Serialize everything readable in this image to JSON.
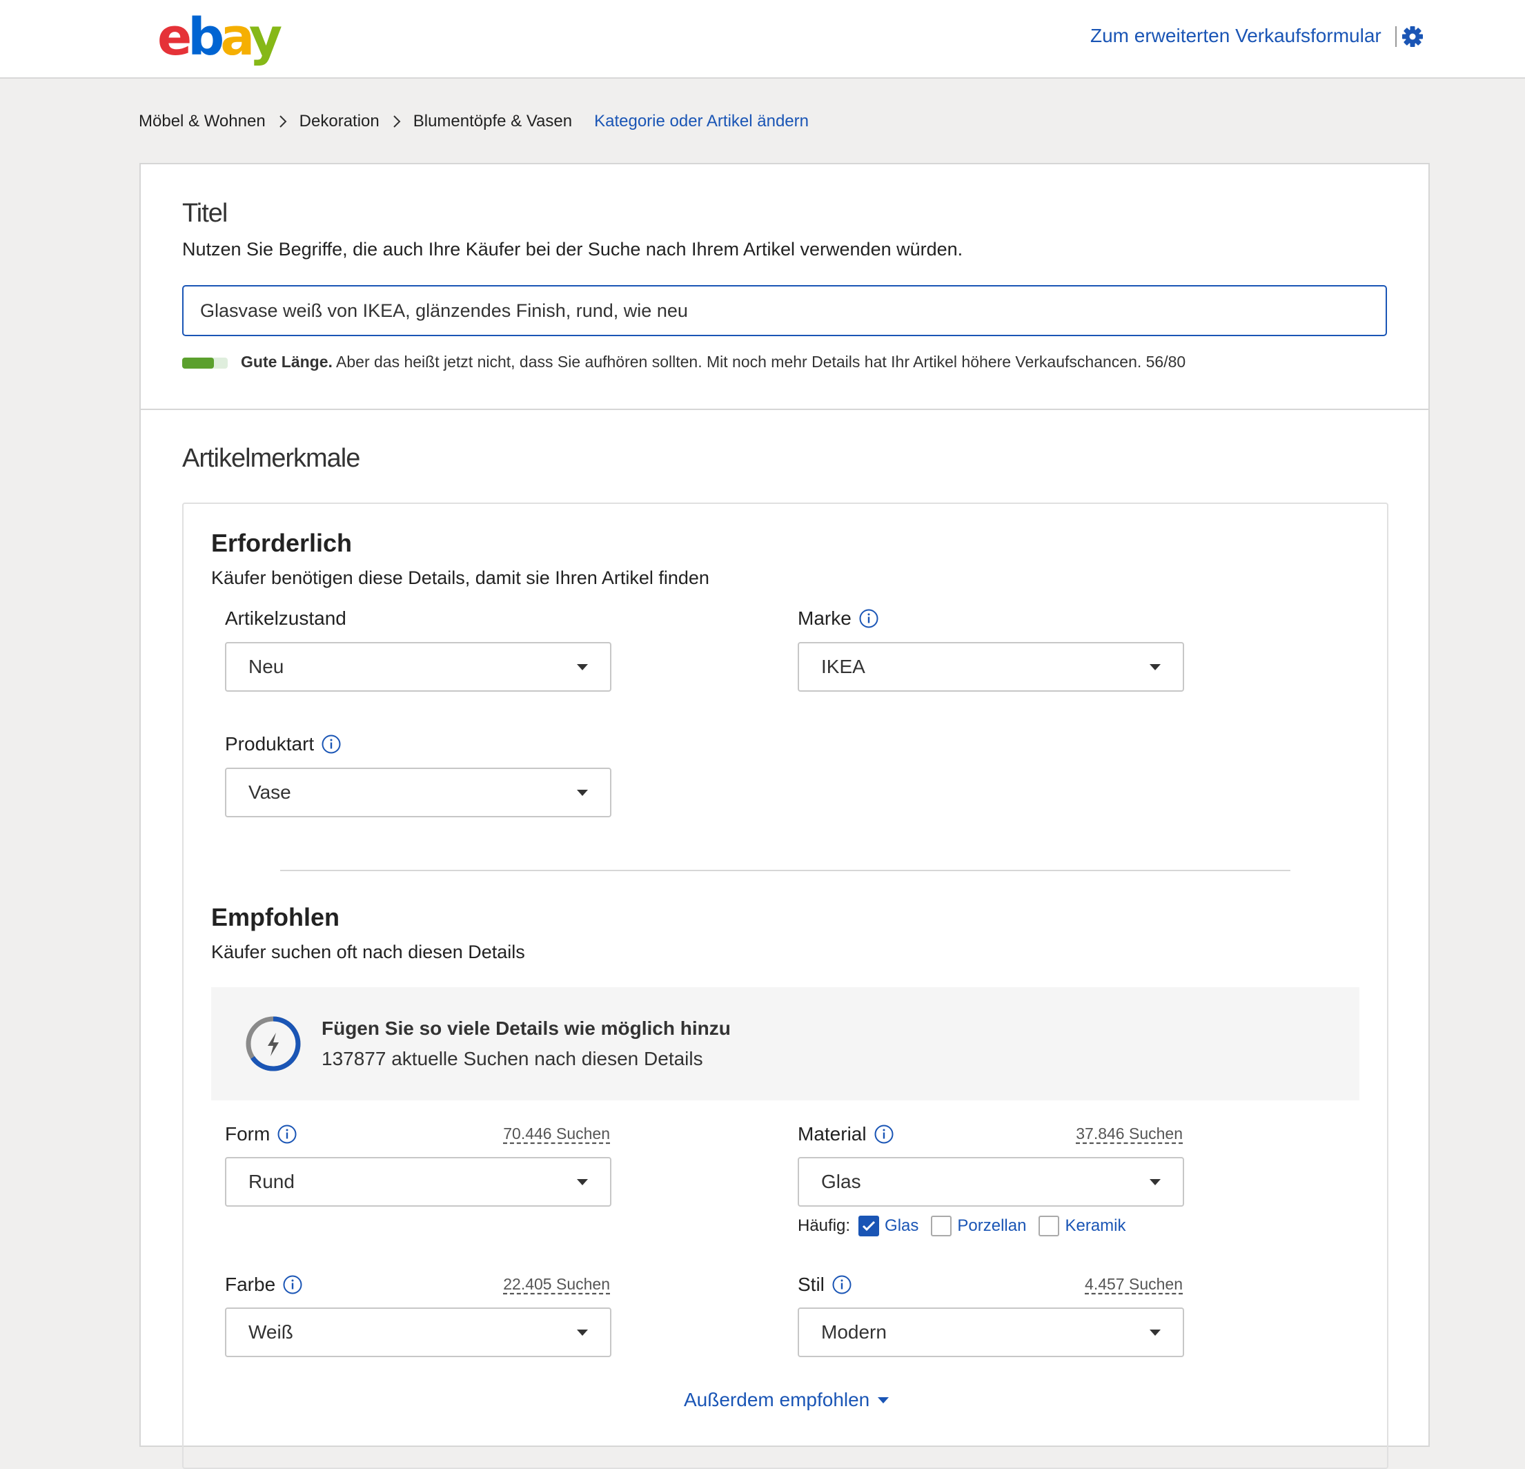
{
  "header": {
    "logo": "ebay",
    "advanced_link": "Zum erweiterten Verkaufsformular",
    "settings_icon": "gear-icon"
  },
  "breadcrumb": {
    "items": [
      "Möbel & Wohnen",
      "Dekoration",
      "Blumentöpfe & Vasen"
    ],
    "change_link": "Kategorie oder Artikel ändern"
  },
  "title_section": {
    "heading": "Titel",
    "hint": "Nutzen Sie Begriffe, die auch Ihre Käufer bei der Suche nach Ihrem Artikel verwenden würden.",
    "value": "Glasvase weiß von IKEA, glänzendes Finish, rund, wie neu",
    "meter_fraction": 0.7,
    "meter_strong": "Gute Länge.",
    "meter_text": " Aber das heißt jetzt nicht, dass Sie aufhören sollten. Mit noch mehr Details hat Ihr Artikel höhere Verkaufschancen. 56/80"
  },
  "features": {
    "heading": "Artikelmerkmale",
    "required": {
      "title": "Erforderlich",
      "subtitle": "Käufer benötigen diese Details, damit sie Ihren Artikel finden",
      "condition": {
        "label": "Artikelzustand",
        "value": "Neu"
      },
      "brand": {
        "label": "Marke",
        "value": "IKEA"
      },
      "product_type": {
        "label": "Produktart",
        "value": "Vase"
      }
    },
    "recommended": {
      "title": "Empfohlen",
      "subtitle": "Käufer suchen oft nach diesen Details",
      "banner_title": "Fügen Sie so viele Details wie möglich hinzu",
      "banner_sub": "137877 aktuelle Suchen nach diesen Details",
      "form": {
        "label": "Form",
        "searches": "70.446 Suchen",
        "value": "Rund"
      },
      "material": {
        "label": "Material",
        "searches": "37.846 Suchen",
        "value": "Glas"
      },
      "frequent_label": "Häufig:",
      "frequent": [
        {
          "label": "Glas",
          "checked": true
        },
        {
          "label": "Porzellan",
          "checked": false
        },
        {
          "label": "Keramik",
          "checked": false
        }
      ],
      "color": {
        "label": "Farbe",
        "searches": "22.405 Suchen",
        "value": "Weiß"
      },
      "style": {
        "label": "Stil",
        "searches": "4.457 Suchen",
        "value": "Modern"
      },
      "more_link": "Außerdem empfohlen"
    }
  },
  "colors": {
    "link": "#1a55b5",
    "meter": "#5ba02d"
  }
}
